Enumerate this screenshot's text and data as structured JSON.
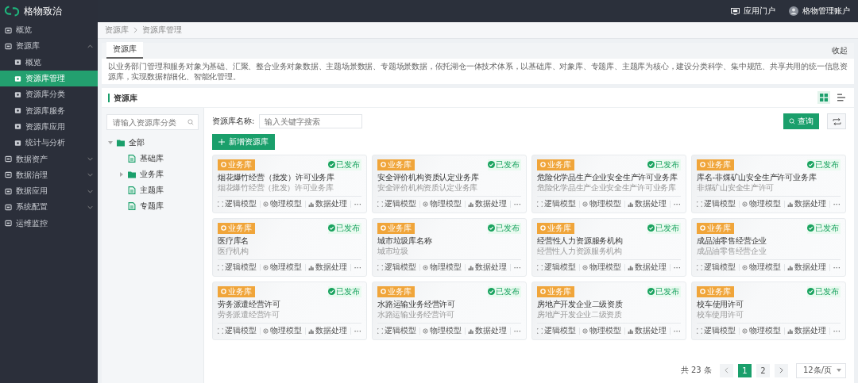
{
  "app": {
    "name": "格物致治"
  },
  "topbar": {
    "portal": "应用门户",
    "account": "格物管理账户"
  },
  "sidebar": {
    "items": [
      {
        "label": "概览",
        "selected": false
      },
      {
        "label": "资源库",
        "selected": false,
        "expanded": true,
        "children": [
          {
            "label": "概览",
            "selected": false
          },
          {
            "label": "资源库管理",
            "selected": true
          },
          {
            "label": "资源库分类",
            "selected": false
          },
          {
            "label": "资源库服务",
            "selected": false
          },
          {
            "label": "资源库应用",
            "selected": false
          },
          {
            "label": "统计与分析",
            "selected": false
          }
        ]
      },
      {
        "label": "数据资产",
        "selected": false,
        "expanded": false
      },
      {
        "label": "数据治理",
        "selected": false,
        "expanded": false
      },
      {
        "label": "数据应用",
        "selected": false,
        "expanded": false
      },
      {
        "label": "系统配置",
        "selected": false,
        "expanded": false
      },
      {
        "label": "运维监控",
        "selected": false
      }
    ]
  },
  "breadcrumb": [
    "资源库",
    "资源库管理"
  ],
  "intro": {
    "tabs": [
      {
        "label": "资源库",
        "selected": true
      }
    ],
    "collapse": "收起",
    "description": "以业务部门管理和服务对象为基础、汇聚、整合业务对象数据、主题场景数据、专题场景数据，依托湖仓一体技术体系，以基础库、对象库、专题库、主题库为核心，建设分类科学、集中规范、共享共用的统一信息资源库，实现数据精细化、智能化管理。"
  },
  "panel": {
    "title": "资源库",
    "view_modes": [
      {
        "kind": "grid",
        "selected": true
      },
      {
        "kind": "list",
        "selected": false
      }
    ]
  },
  "tree": {
    "placeholder": "请输入资源库分类",
    "nodes": [
      {
        "label": "全部",
        "kind": "folder",
        "expanded": true,
        "children": [
          {
            "label": "基础库",
            "kind": "file"
          },
          {
            "label": "业务库",
            "kind": "folder",
            "expanded": false
          },
          {
            "label": "主题库",
            "kind": "file"
          },
          {
            "label": "专题库",
            "kind": "file"
          }
        ]
      }
    ]
  },
  "filter": {
    "label": "资源库名称:",
    "placeholder": "输入关键字搜索",
    "search_button": "查询",
    "add_button": "新增资源库"
  },
  "cards": [
    {
      "tag": "业务库",
      "status": "已发布",
      "title": "烟花爆竹经营（批发）许可业务库",
      "subtitle": "烟花爆竹经营（批发）许可业务库",
      "actions": [
        "逻辑模型",
        "物理模型",
        "数据处理",
        "···"
      ]
    },
    {
      "tag": "业务库",
      "status": "已发布",
      "title": "安全评价机构资质认定业务库",
      "subtitle": "安全评价机构资质认定业务库",
      "actions": [
        "逻辑模型",
        "物理模型",
        "数据处理",
        "···"
      ]
    },
    {
      "tag": "业务库",
      "status": "已发布",
      "title": "危险化学品生产企业安全生产许可业务库",
      "subtitle": "危险化学品生产企业安全生产许可业务库",
      "actions": [
        "逻辑模型",
        "物理模型",
        "数据处理",
        "···"
      ]
    },
    {
      "tag": "业务库",
      "status": "已发布",
      "title": "库名-非煤矿山安全生产许可业务库",
      "subtitle": "非煤矿山安全生产许可",
      "actions": [
        "逻辑模型",
        "物理模型",
        "数据处理",
        "···"
      ]
    },
    {
      "tag": "业务库",
      "status": "已发布",
      "title": "医疗库名",
      "subtitle": "医疗机构",
      "actions": [
        "逻辑模型",
        "物理模型",
        "数据处理",
        "···"
      ]
    },
    {
      "tag": "业务库",
      "status": "已发布",
      "title": "城市垃圾库名称",
      "subtitle": "城市垃圾",
      "actions": [
        "逻辑模型",
        "物理模型",
        "数据处理",
        "···"
      ]
    },
    {
      "tag": "业务库",
      "status": "已发布",
      "title": "经营性人力资源服务机构",
      "subtitle": "经营性人力资源服务机构",
      "actions": [
        "逻辑模型",
        "物理模型",
        "数据处理",
        "···"
      ]
    },
    {
      "tag": "业务库",
      "status": "已发布",
      "title": "成品油零售经营企业",
      "subtitle": "成品油零售经营企业",
      "actions": [
        "逻辑模型",
        "物理模型",
        "数据处理",
        "···"
      ]
    },
    {
      "tag": "业务库",
      "status": "已发布",
      "title": "劳务派遣经营许可",
      "subtitle": "劳务派遣经营许可",
      "actions": [
        "逻辑模型",
        "物理模型",
        "数据处理",
        "···"
      ]
    },
    {
      "tag": "业务库",
      "status": "已发布",
      "title": "水路运输业务经营许可",
      "subtitle": "水路运输业务经营许可",
      "actions": [
        "逻辑模型",
        "物理模型",
        "数据处理",
        "···"
      ]
    },
    {
      "tag": "业务库",
      "status": "已发布",
      "title": "房地产开发企业二级资质",
      "subtitle": "房地产开发企业二级资质",
      "actions": [
        "逻辑模型",
        "物理模型",
        "数据处理",
        "···"
      ]
    },
    {
      "tag": "业务库",
      "status": "已发布",
      "title": "校车使用许可",
      "subtitle": "校车使用许可",
      "actions": [
        "逻辑模型",
        "物理模型",
        "数据处理",
        "···"
      ]
    }
  ],
  "pagination": {
    "total": "共 23 条",
    "pages": [
      {
        "label": "1",
        "selected": true
      },
      {
        "label": "2",
        "selected": false
      }
    ],
    "page_size": "12条/页"
  }
}
